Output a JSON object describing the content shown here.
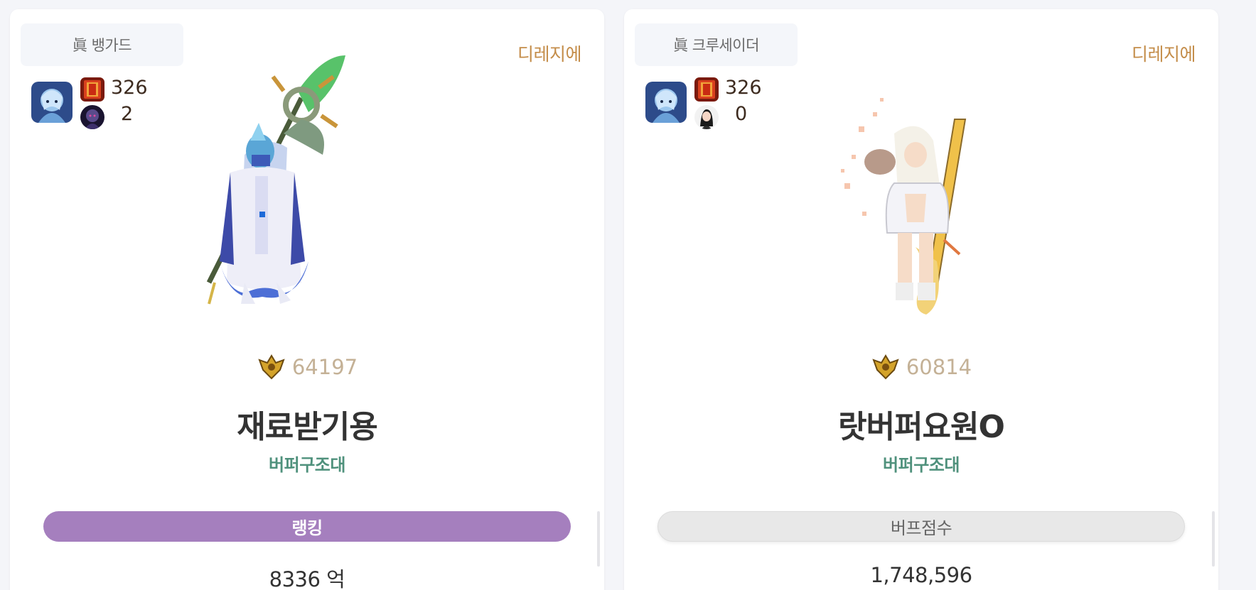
{
  "cards": [
    {
      "job": "眞 뱅가드",
      "server": "디레지에",
      "avatar_icon": "character-avatar-icon",
      "stat1": "326",
      "stat2": "2",
      "score": "64197",
      "name": "재료받기용",
      "guild": "버퍼구조대",
      "tab_label": "랭킹",
      "value": "8336 억"
    },
    {
      "job": "眞 크루세이더",
      "server": "디레지에",
      "avatar_icon": "character-avatar-icon",
      "stat1": "326",
      "stat2": "0",
      "score": "60814",
      "name": "랏버퍼요원O",
      "guild": "버퍼구조대",
      "tab_label": "버프점수",
      "value": "1,748,596"
    }
  ],
  "colors": {
    "server": "#c48d4a",
    "guild": "#4f917c",
    "ranking_pill": "#a57fbe",
    "score_text": "#c4b196"
  }
}
